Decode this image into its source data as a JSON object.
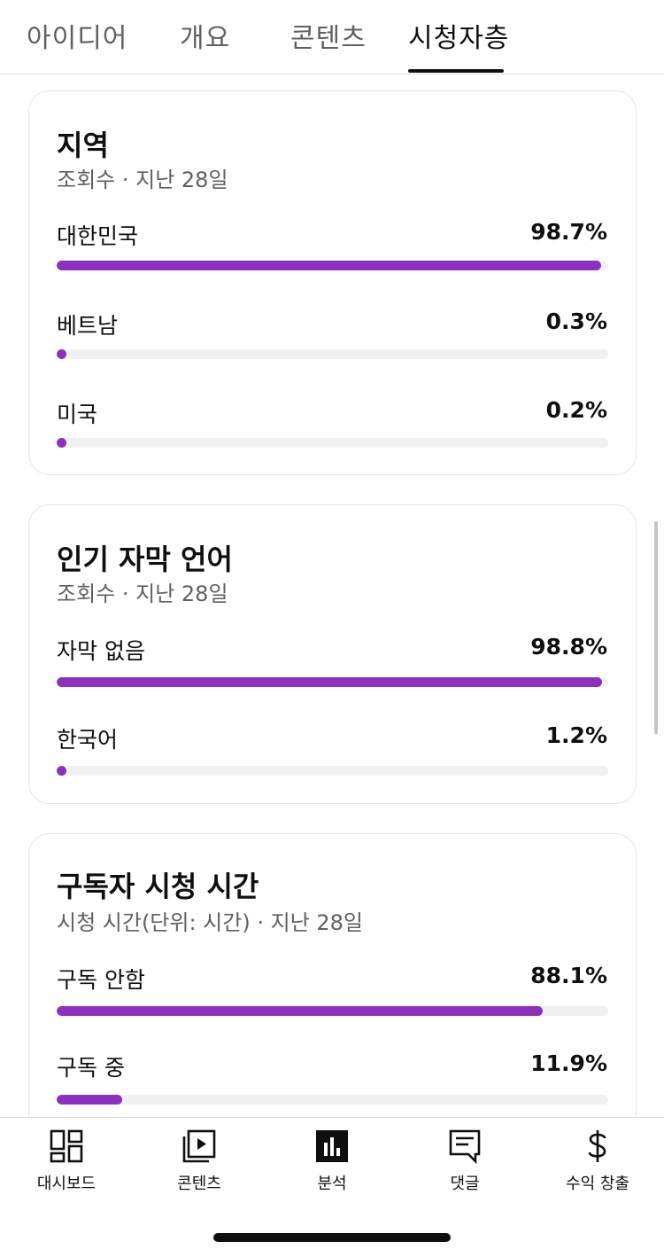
{
  "top_tabs": [
    {
      "label": "아이디어",
      "active": false
    },
    {
      "label": "개요",
      "active": false
    },
    {
      "label": "콘텐츠",
      "active": false
    },
    {
      "label": "시청자층",
      "active": true
    }
  ],
  "cards": [
    {
      "title": "지역",
      "subtitle": "조회수 · 지난 28일",
      "rows": [
        {
          "label": "대한민국",
          "value": "98.7%",
          "fraction": 0.987
        },
        {
          "label": "베트남",
          "value": "0.3%",
          "fraction": 0.003
        },
        {
          "label": "미국",
          "value": "0.2%",
          "fraction": 0.002
        }
      ]
    },
    {
      "title": "인기 자막 언어",
      "subtitle": "조회수 · 지난 28일",
      "rows": [
        {
          "label": "자막 없음",
          "value": "98.8%",
          "fraction": 0.988
        },
        {
          "label": "한국어",
          "value": "1.2%",
          "fraction": 0.012
        }
      ]
    },
    {
      "title": "구독자 시청 시간",
      "subtitle": "시청 시간(단위: 시간) · 지난 28일",
      "rows": [
        {
          "label": "구독 안함",
          "value": "88.1%",
          "fraction": 0.881
        },
        {
          "label": "구독 중",
          "value": "11.9%",
          "fraction": 0.119
        }
      ]
    }
  ],
  "bottom_nav": [
    {
      "label": "대시보드",
      "icon": "dashboard-icon",
      "active": false
    },
    {
      "label": "콘텐츠",
      "icon": "content-icon",
      "active": false
    },
    {
      "label": "분석",
      "icon": "analytics-icon",
      "active": true
    },
    {
      "label": "댓글",
      "icon": "comments-icon",
      "active": false
    },
    {
      "label": "수익 창출",
      "icon": "earn-icon",
      "active": false
    }
  ],
  "colors": {
    "accent_bar": "#8d2fc0",
    "track": "#f0f0f0"
  }
}
